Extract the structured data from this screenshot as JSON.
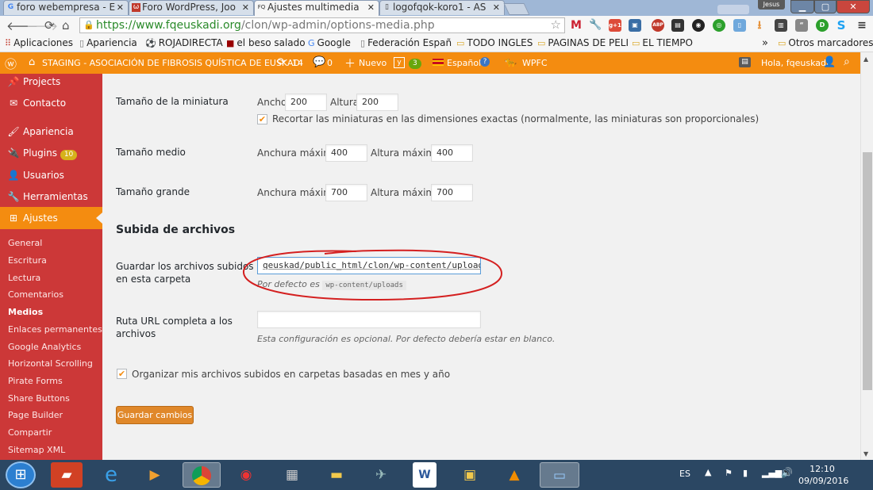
{
  "browser": {
    "tabs": [
      {
        "favicon": "G",
        "title": "foro webempresa - E",
        "active": false
      },
      {
        "favicon": "ω",
        "title": "Foro WordPress, Joo",
        "active": false
      },
      {
        "favicon": "FQ",
        "title": "Ajustes multimedia",
        "active": true
      },
      {
        "favicon": "▯",
        "title": "logofqok-koro1 - AS",
        "active": false
      }
    ],
    "user_tag": "Jesus",
    "url_host": "https://www.fqeuskadi.org",
    "url_path": "/clon/wp-admin/options-media.php",
    "bookmarks": [
      "Aplicaciones",
      "Apariencia",
      "ROJADIRECTA",
      "el beso salado",
      "Google",
      "Federación Españ",
      "TODO INGLES",
      "PAGINAS DE PELI",
      "EL TIEMPO",
      "Otros marcadores"
    ],
    "bookmarks_more": "»"
  },
  "adminbar": {
    "site_name": "STAGING - ASOCIACIÓN DE FIBROSIS QUÍSTICA DE EUSKADI",
    "updates": "14",
    "comments": "0",
    "new": "Nuevo",
    "yoast_count": "3",
    "language": "Español",
    "wpfc": "WPFC",
    "greeting": "Hola, fqeuskadi"
  },
  "sidebar": {
    "items": [
      {
        "label": "Projects",
        "icon": "pin-icon"
      },
      {
        "label": "Contacto",
        "icon": "mail-icon"
      },
      {
        "label": "Apariencia",
        "icon": "brush-icon"
      },
      {
        "label": "Plugins",
        "icon": "plugin-icon",
        "badge": "10"
      },
      {
        "label": "Usuarios",
        "icon": "user-icon"
      },
      {
        "label": "Herramientas",
        "icon": "wrench-icon"
      },
      {
        "label": "Ajustes",
        "icon": "settings-icon"
      }
    ],
    "submenu": [
      "General",
      "Escritura",
      "Lectura",
      "Comentarios",
      "Medios",
      "Enlaces permanentes",
      "Google Analytics",
      "Horizontal Scrolling",
      "Pirate Forms",
      "Share Buttons",
      "Page Builder",
      "Compartir",
      "Sitemap XML"
    ],
    "current_submenu": "Medios"
  },
  "main": {
    "thumbnail": {
      "label": "Tamaño de la miniatura",
      "width_label": "Ancho",
      "width": "200",
      "height_label": "Altura",
      "height": "200",
      "crop_label": "Recortar las miniaturas en las dimensiones exactas (normalmente, las miniaturas son proporcionales)",
      "crop_checked": true
    },
    "medium": {
      "label": "Tamaño medio",
      "width_label": "Anchura máxima",
      "width": "400",
      "height_label": "Altura máxima",
      "height": "400"
    },
    "large": {
      "label": "Tamaño grande",
      "width_label": "Anchura máxima",
      "width": "700",
      "height_label": "Altura máxima",
      "height": "700"
    },
    "uploads_heading": "Subida de archivos",
    "upload_path": {
      "label_line1": "Guardar los archivos subidos",
      "label_line2": "en esta carpeta",
      "value": "qeuskad/public_html/clon/wp-content/uploads/",
      "default_prefix": "Por defecto es",
      "default_value": "wp-content/uploads"
    },
    "url_path": {
      "label_line1": "Ruta URL completa a los",
      "label_line2": "archivos",
      "value": "",
      "hint": "Esta configuración es opcional. Por defecto debería estar en blanco."
    },
    "organize": {
      "label": "Organizar mis archivos subidos en carpetas basadas en mes y año",
      "checked": true
    },
    "save_button": "Guardar cambios"
  },
  "taskbar": {
    "lang": "ES",
    "time": "12:10",
    "date": "09/09/2016"
  },
  "colors": {
    "adminbar": "#f48c10",
    "sidebar": "#cc3838",
    "button": "#e0882a",
    "annotation": "#d42020",
    "taskbar": "#2b4763"
  }
}
